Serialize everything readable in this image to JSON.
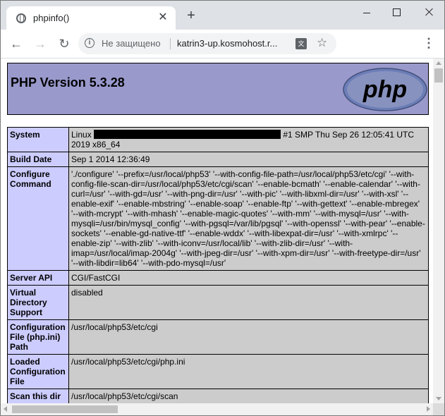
{
  "browser": {
    "tab_title": "phpinfo()",
    "tab_close": "✕",
    "new_tab": "+",
    "security_label": "Не защищено",
    "url": "katrin3-up.kosmohost.r...",
    "icons": [
      "globe-icon",
      "back-icon",
      "forward-icon",
      "reload-icon",
      "info-icon",
      "translate-icon",
      "star-icon",
      "menu-icon"
    ]
  },
  "php": {
    "version_title": "PHP Version 5.3.28",
    "logo_text": "php",
    "header_color": "#9999cc",
    "key_color": "#ccccff",
    "value_color": "#cccccc"
  },
  "rows": [
    {
      "key": "System",
      "value_prefix": "Linux",
      "value": "#1 SMP Thu Sep 26 12:05:41 UTC 2019 x86_64"
    },
    {
      "key": "Build Date",
      "value": "Sep 1 2014 12:36:49"
    },
    {
      "key": "Configure Command",
      "value": "'./configure' '--prefix=/usr/local/php53' '--with-config-file-path=/usr/local/php53/etc/cgi' '--with-config-file-scan-dir=/usr/local/php53/etc/cgi/scan' '--enable-bcmath' '--enable-calendar' '--with-curl=/usr' '--with-gd=/usr' '--with-png-dir=/usr' '--with-pic' '--with-libxml-dir=/usr' '--with-xsl' '--enable-exif' '--enable-mbstring' '--enable-soap' '--enable-ftp' '--with-gettext' '--enable-mbregex' '--with-mcrypt' '--with-mhash' '--enable-magic-quotes' '--with-mm' '--with-mysql=/usr' '--with-mysqli=/usr/bin/mysql_config' '--with-pgsql=/var/lib/pgsql' '--with-openssl' '--with-pear' '--enable-sockets' '--enable-gd-native-ttf' '--enable-wddx' '--with-libexpat-dir=/usr' '--with-xmlrpc' '--enable-zip' '--with-zlib' '--with-iconv=/usr/local/lib' '--with-zlib-dir=/usr' '--with-imap=/usr/local/imap-2004g' '--with-jpeg-dir=/usr' '--with-xpm-dir=/usr' '--with-freetype-dir=/usr' '--with-libdir=lib64' '--with-pdo-mysql=/usr'"
    },
    {
      "key": "Server API",
      "value": "CGI/FastCGI"
    },
    {
      "key": "Virtual Directory Support",
      "value": "disabled"
    },
    {
      "key": "Configuration File (php.ini) Path",
      "value": "/usr/local/php53/etc/cgi"
    },
    {
      "key": "Loaded Configuration File",
      "value": "/usr/local/php53/etc/cgi/php.ini"
    },
    {
      "key": "Scan this dir",
      "value": "/usr/local/php53/etc/cgi/scan"
    }
  ]
}
